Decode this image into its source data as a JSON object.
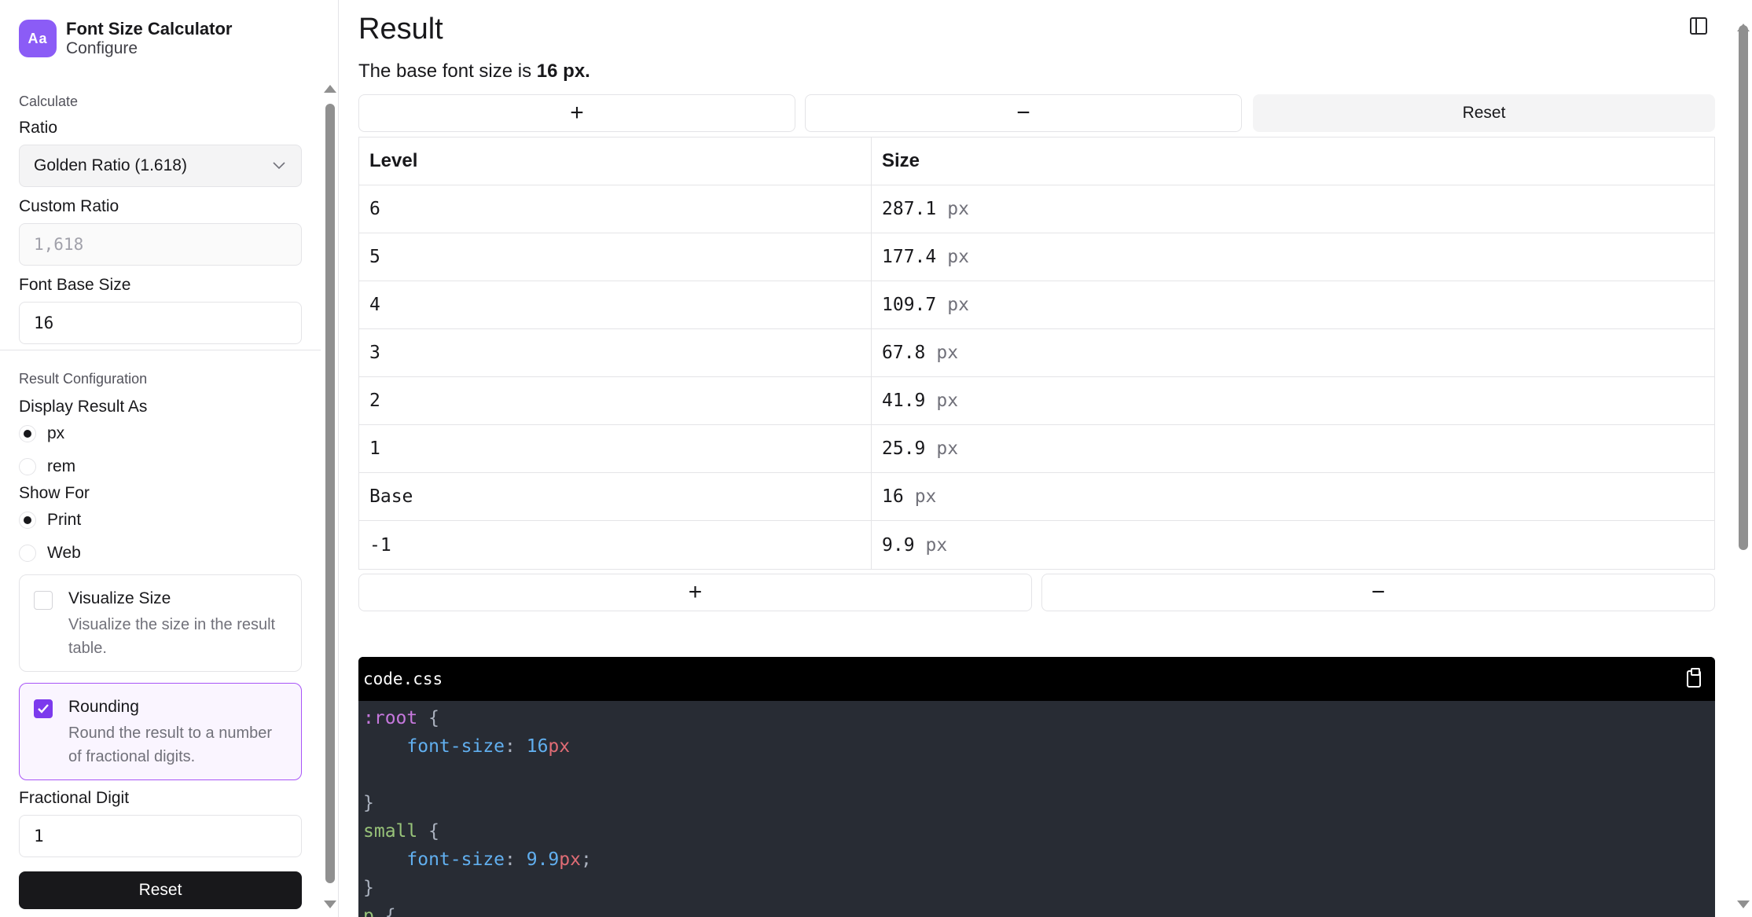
{
  "app": {
    "logo": "Aa",
    "title": "Font Size Calculator",
    "subtitle": "Configure"
  },
  "sidebar": {
    "calculate_section": "Calculate",
    "ratio": {
      "label": "Ratio",
      "value": "Golden Ratio (1.618)"
    },
    "custom_ratio": {
      "label": "Custom Ratio",
      "placeholder": "1,618"
    },
    "font_base": {
      "label": "Font Base Size",
      "value": "16"
    },
    "result_section": "Result Configuration",
    "display_as": {
      "label": "Display Result As",
      "options": [
        "px",
        "rem"
      ],
      "selected": "px"
    },
    "show_for": {
      "label": "Show For",
      "options": [
        "Print",
        "Web"
      ],
      "selected": "Print"
    },
    "visualize": {
      "title": "Visualize Size",
      "desc1": "Visualize the size in the result",
      "desc2": "table.",
      "checked": false
    },
    "rounding": {
      "title": "Rounding",
      "desc1": "Round the result to a number",
      "desc2": "of fractional digits.",
      "checked": true
    },
    "fractional": {
      "label": "Fractional Digit",
      "value": "1"
    },
    "reset_label": "Reset"
  },
  "main": {
    "title": "Result",
    "base_text_prefix": "The base font size is",
    "base_text_value": "16 px.",
    "plus": "+",
    "minus": "−",
    "reset": "Reset",
    "table": {
      "headers": [
        "Level",
        "Size"
      ],
      "unit": "px",
      "rows": [
        {
          "level": "6",
          "size": "287.1"
        },
        {
          "level": "5",
          "size": "177.4"
        },
        {
          "level": "4",
          "size": "109.7"
        },
        {
          "level": "3",
          "size": "67.8"
        },
        {
          "level": "2",
          "size": "41.9"
        },
        {
          "level": "1",
          "size": "25.9"
        },
        {
          "level": "Base",
          "size": "16"
        },
        {
          "level": "-1",
          "size": "9.9"
        }
      ]
    },
    "code": {
      "filename": "code.css",
      "lines": [
        [
          [
            ":root",
            "sel"
          ],
          [
            " {",
            "p"
          ]
        ],
        [
          [
            "    ",
            "p"
          ],
          [
            "font-size",
            "prop"
          ],
          [
            ": ",
            "p"
          ],
          [
            "16",
            "num"
          ],
          [
            "px",
            "unit"
          ]
        ],
        [
          [
            "",
            "p"
          ]
        ],
        [
          [
            "}",
            "p"
          ]
        ],
        [
          [
            "small",
            "tag"
          ],
          [
            " {",
            "p"
          ]
        ],
        [
          [
            "    ",
            "p"
          ],
          [
            "font-size",
            "prop"
          ],
          [
            ": ",
            "p"
          ],
          [
            "9.9",
            "num"
          ],
          [
            "px",
            "unit"
          ],
          [
            ";",
            "p"
          ]
        ],
        [
          [
            "}",
            "p"
          ]
        ],
        [
          [
            "p",
            "tag"
          ],
          [
            " {",
            "p"
          ]
        ]
      ]
    }
  }
}
